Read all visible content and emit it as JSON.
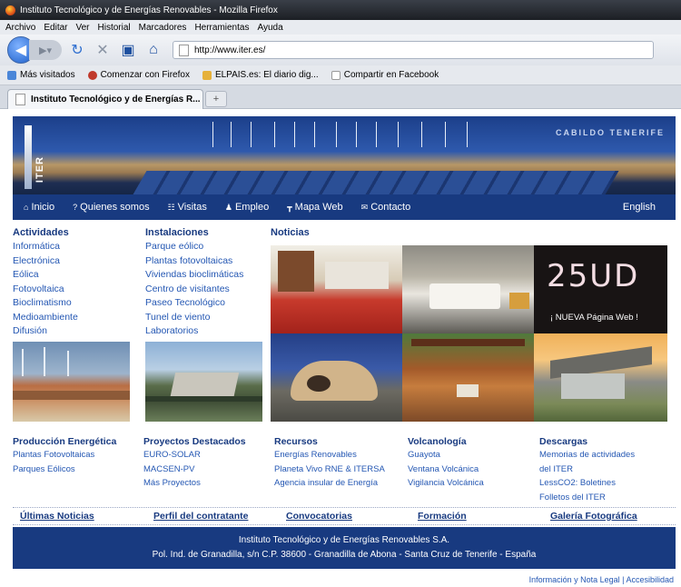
{
  "window": {
    "title": "Instituto Tecnológico y de Energías Renovables - Mozilla Firefox"
  },
  "menu": [
    "Archivo",
    "Editar",
    "Ver",
    "Historial",
    "Marcadores",
    "Herramientas",
    "Ayuda"
  ],
  "url": "http://www.iter.es/",
  "bookmarks": [
    "Más visitados",
    "Comenzar con Firefox",
    "ELPAIS.es: El diario dig...",
    "Compartir en Facebook"
  ],
  "tab": {
    "label": "Instituto Tecnológico y de Energías R...",
    "new": "+"
  },
  "banner": {
    "logo": "ITER",
    "brand": "CABILDO TENERIFE"
  },
  "nav": {
    "items": [
      "Inicio",
      "Quienes somos",
      "Visitas",
      "Empleo",
      "Mapa Web",
      "Contacto"
    ],
    "english": "English"
  },
  "actividades": {
    "title": "Actividades",
    "items": [
      "Informática",
      "Electrónica",
      "Eólica",
      "Fotovoltaica",
      "Bioclimatismo",
      "Medioambiente",
      "Difusión"
    ]
  },
  "instalaciones": {
    "title": "Instalaciones",
    "items": [
      "Parque eólico",
      "Plantas fotovoltaicas",
      "Viviendas bioclimáticas",
      "Centro de visitantes",
      "Paseo Tecnológico",
      "Tunel de viento",
      "Laboratorios"
    ]
  },
  "noticias": {
    "title": "Noticias",
    "promo_number": "25UD",
    "promo_text": "¡ NUEVA Página Web !"
  },
  "produccion": {
    "title": "Producción Energética",
    "items": [
      "Plantas Fotovoltaicas",
      "Parques Eólicos"
    ]
  },
  "proyectos": {
    "title": "Proyectos Destacados",
    "items": [
      "EURO-SOLAR",
      "MACSEN-PV",
      "Más Proyectos"
    ]
  },
  "recursos": {
    "title": "Recursos",
    "items": [
      "Energías Renovables",
      "Planeta Vivo RNE & ITERSA",
      "Agencia insular de Energía"
    ]
  },
  "volcanologia": {
    "title": "Volcanología",
    "items": [
      "Guayota",
      "Ventana Volcánica",
      "Vigilancia Volcánica"
    ]
  },
  "descargas": {
    "title": "Descargas",
    "items": [
      "Memorias de actividades",
      "del ITER",
      "LessCO2: Boletines",
      "Folletos del ITER"
    ]
  },
  "tabs": [
    "Últimas Noticias",
    "Perfil del contratante",
    "Convocatorias",
    "Formación",
    "Galería Fotográfica"
  ],
  "footer": {
    "line1": "Instituto Tecnológico y de Energías Renovables S.A.",
    "line2": "Pol. Ind. de Granadilla, s/n C.P. 38600 - Granadilla de Abona - Santa Cruz de Tenerife - España"
  },
  "legal": "Información y Nota Legal | Accesibilidad",
  "colors": {
    "brand": "#183a80",
    "link": "#2457b3"
  }
}
